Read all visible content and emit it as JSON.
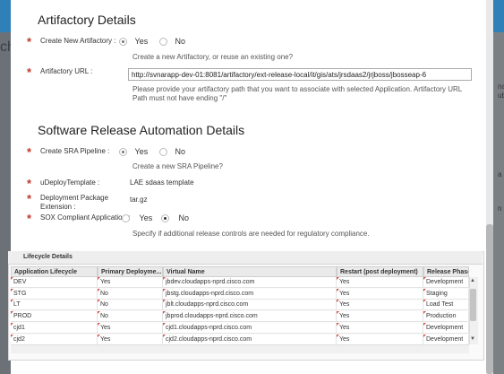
{
  "background": {
    "left_text": "ch",
    "right_fragments": [
      "na",
      "ub",
      "a",
      "n"
    ]
  },
  "artifactory": {
    "title": "Artifactory Details",
    "create_label": "Create New Artifactory :",
    "yes": "Yes",
    "no": "No",
    "create_help": "Create a new Artifactory, or reuse an existing one?",
    "url_label": "Artifactory URL :",
    "url_value": "http://svnarapp-dev-01:8081/artifactory/ext-release-local/it/gis/ats/jrsdaas2/jrjboss/jbosseap-6",
    "url_help_1": "Please provide your artifactory path that you want to associate with selected Application. Artifactory URL",
    "url_help_2": "Path must not have ending \"/\""
  },
  "sra": {
    "title": "Software Release Automation Details",
    "pipeline_label": "Create SRA Pipeline :",
    "yes": "Yes",
    "no": "No",
    "pipeline_help": "Create a new SRA Pipeline?",
    "udeploy_label": "uDeployTemplate :",
    "udeploy_value": "LAE sdaas template",
    "pkg_label_1": "Deployment Package",
    "pkg_label_2": "Extension :",
    "pkg_value": "tar.gz",
    "sox_label": "SOX Compliant Application :",
    "sox_yes": "Yes",
    "sox_no": "No",
    "sox_help": "Specify if additional release controls are needed for regulatory compliance."
  },
  "lifecycle": {
    "title": "Lifecycle Details",
    "columns": [
      "Application Lifecycle",
      "Primary Deployme...",
      "Virtual Name",
      "Restart (post deployment)",
      "Release Phase"
    ],
    "rows": [
      [
        "DEV",
        "Yes",
        "jbdev.cloudapps-nprd.cisco.com",
        "Yes",
        "Development"
      ],
      [
        "STG",
        "No",
        "jbstg.cloudapps-nprd.cisco.com",
        "Yes",
        "Staging"
      ],
      [
        "LT",
        "No",
        "jblt.cloudapps-nprd.cisco.com",
        "Yes",
        "Load Test"
      ],
      [
        "PROD",
        "No",
        "jbprod.cloudapps-nprd.cisco.com",
        "Yes",
        "Production"
      ],
      [
        "cjd1",
        "Yes",
        "cjd1.cloudapps-nprd.cisco.com",
        "Yes",
        "Development"
      ],
      [
        "cjd2",
        "Yes",
        "cjd2.cloudapps-nprd.cisco.com",
        "Yes",
        "Development"
      ]
    ]
  }
}
